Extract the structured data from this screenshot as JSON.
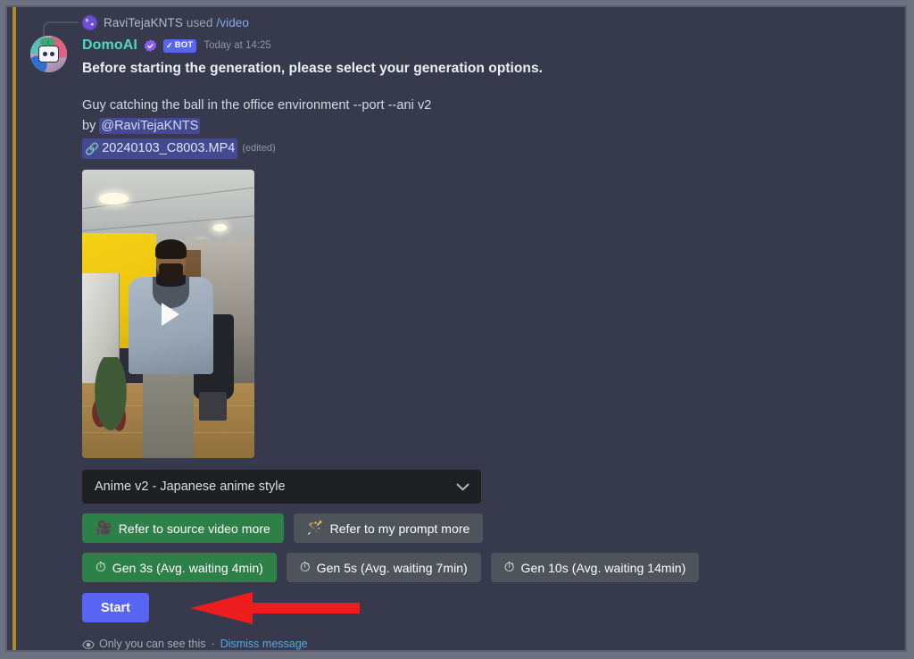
{
  "window": {
    "background_color": "#373a4d",
    "accent_bar_color": "#b08b2e",
    "frame_border_color": "#5c5f70"
  },
  "command_header": {
    "avatar_name": "raviteja-user-avatar",
    "username": "RaviTejaKNTS",
    "used_text": "used",
    "command": "/video"
  },
  "bot_message": {
    "avatar_name": "domoai-bot-avatar",
    "name": "DomoAI",
    "name_color": "#4fd6c4",
    "verified_icon": "verified-badge-icon",
    "bot_tag": "BOT",
    "bot_tag_check": "✓",
    "bot_tag_color": "#5865f2",
    "timestamp": "Today at 14:25",
    "title": "Before starting the generation, please select your generation options."
  },
  "generation_info": {
    "prompt": "Guy catching the ball in the office environment --port --ani v2",
    "by_prefix": "by",
    "by_mention": "@RaviTejaKNTS",
    "attachment_icon": "paperclip-icon",
    "attachment_name": "20240103_C8003.MP4",
    "edited_label": "(edited)"
  },
  "video_thumbnail": {
    "name": "video-preview-thumbnail",
    "play_icon": "play-button-icon",
    "description": "Man in gray sweater standing in an office with a yellow wall"
  },
  "style_select": {
    "name": "style-dropdown",
    "selected": "Anime v2 - Japanese anime style",
    "chevron_icon": "chevron-down-icon",
    "background_color": "#1e1f22"
  },
  "reference_buttons": [
    {
      "label": "Refer to source video more",
      "emoji": "🎥",
      "emoji_name": "video-camera-emoji",
      "style": "green",
      "color": "#2e8049",
      "selected": true
    },
    {
      "label": "Refer to my prompt more",
      "emoji": "🪄",
      "emoji_name": "magic-wand-emoji",
      "style": "grey",
      "color": "#4f545c",
      "selected": false
    }
  ],
  "duration_buttons": [
    {
      "label": "Gen 3s (Avg. waiting 4min)",
      "emoji": "⏱",
      "emoji_name": "stopwatch-emoji",
      "style": "green",
      "color": "#2e8049",
      "selected": true
    },
    {
      "label": "Gen 5s (Avg. waiting 7min)",
      "emoji": "⏱",
      "emoji_name": "stopwatch-emoji",
      "style": "grey",
      "color": "#4f545c",
      "selected": false
    },
    {
      "label": "Gen 10s (Avg. waiting 14min)",
      "emoji": "⏱",
      "emoji_name": "stopwatch-emoji",
      "style": "grey",
      "color": "#4f545c",
      "selected": false
    }
  ],
  "start_button": {
    "label": "Start",
    "color": "#5865f2"
  },
  "annotation": {
    "name": "red-arrow-pointing-to-start-button",
    "color": "#ee1d1d",
    "points_to": "Start"
  },
  "ephemeral_footer": {
    "eye_icon": "eye-icon",
    "text": "Only you can see this",
    "separator": "·",
    "dismiss_label": "Dismiss message",
    "dismiss_color": "#55a8e8"
  }
}
